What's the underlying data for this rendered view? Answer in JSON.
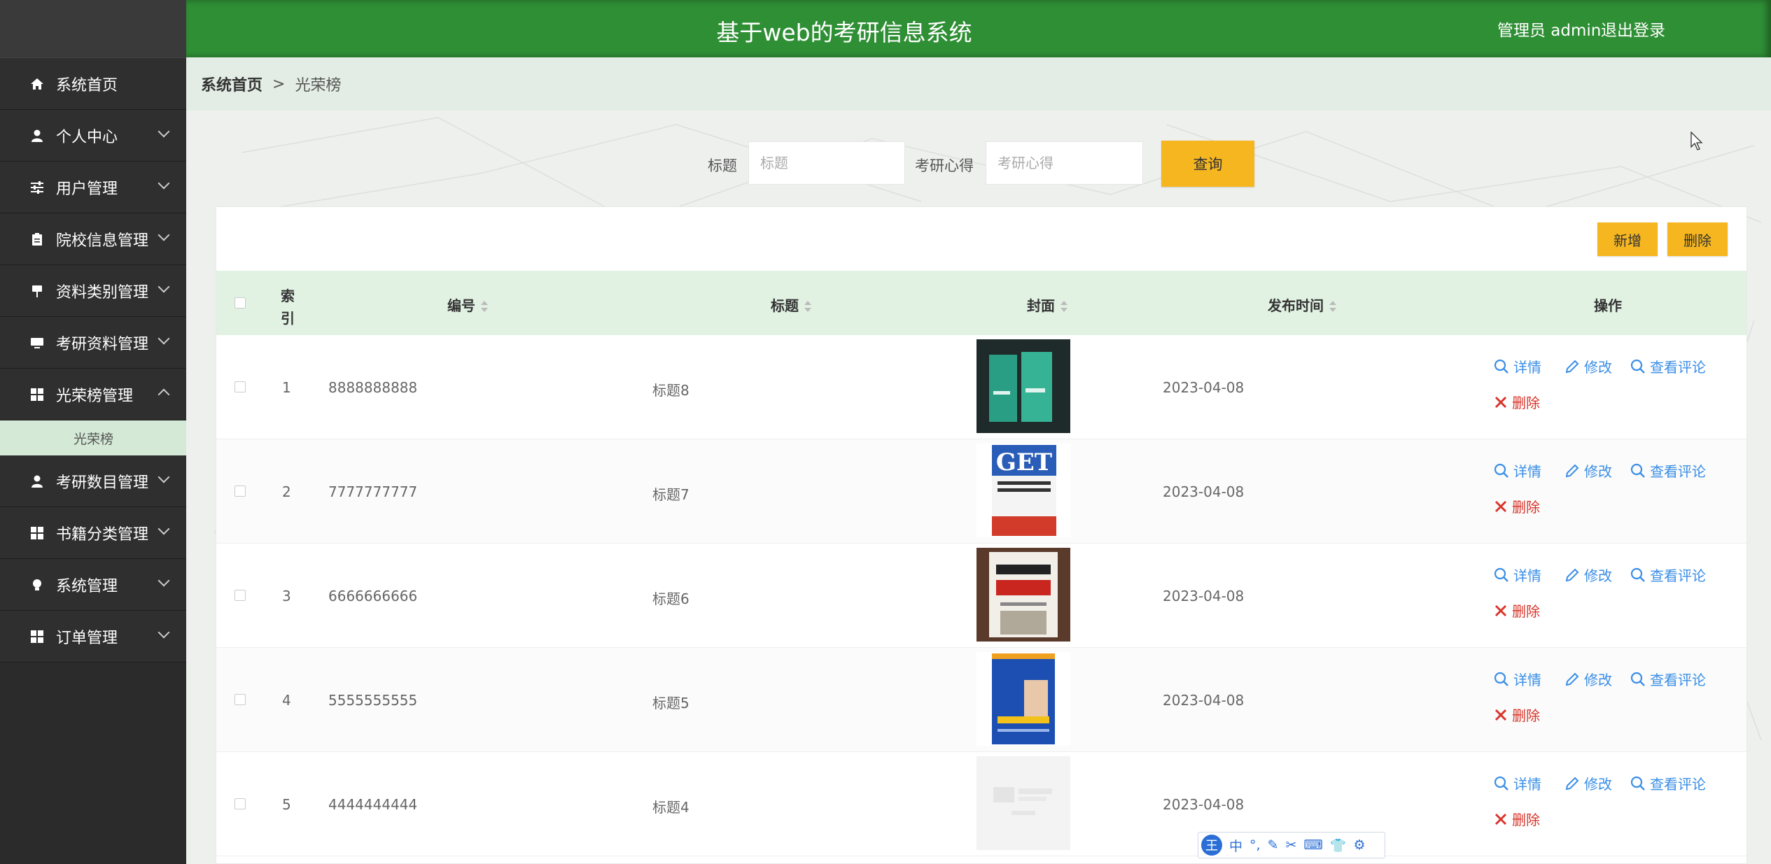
{
  "header": {
    "title": "基于web的考研信息系统",
    "user": "管理员 admin",
    "logout": "退出登录"
  },
  "sidebar": {
    "items": [
      {
        "label": "系统首页",
        "icon": "home-icon"
      },
      {
        "label": "个人中心",
        "icon": "user-icon"
      },
      {
        "label": "用户管理",
        "icon": "sliders-icon"
      },
      {
        "label": "院校信息管理",
        "icon": "clipboard-icon"
      },
      {
        "label": "资料类别管理",
        "icon": "sign-icon"
      },
      {
        "label": "考研资料管理",
        "icon": "monitor-icon"
      },
      {
        "label": "光荣榜管理",
        "icon": "grid-icon"
      },
      {
        "label": "考研数目管理",
        "icon": "user-icon"
      },
      {
        "label": "书籍分类管理",
        "icon": "grid-icon"
      },
      {
        "label": "系统管理",
        "icon": "bulb-icon"
      },
      {
        "label": "订单管理",
        "icon": "grid-icon"
      }
    ],
    "submenu": {
      "label": "光荣榜"
    }
  },
  "breadcrumb": {
    "home": "系统首页",
    "sep": ">",
    "current": "光荣榜"
  },
  "search": {
    "title_label": "标题",
    "title_placeholder": "标题",
    "xinde_label": "考研心得",
    "xinde_placeholder": "考研心得",
    "query": "查询"
  },
  "toolbar": {
    "add": "新增",
    "delete": "删除"
  },
  "table": {
    "headers": {
      "index": "索引",
      "number": "编号",
      "title": "标题",
      "cover": "封面",
      "date": "发布时间",
      "ops": "操作"
    },
    "rows": [
      {
        "index": "1",
        "number": "8888888888",
        "title": "标题8",
        "date": "2023-04-08",
        "cover": "green-book-cover"
      },
      {
        "index": "2",
        "number": "7777777777",
        "title": "标题7",
        "date": "2023-04-08",
        "cover": "get-book-cover"
      },
      {
        "index": "3",
        "number": "6666666666",
        "title": "标题6",
        "date": "2023-04-08",
        "cover": "english-book-cover"
      },
      {
        "index": "4",
        "number": "5555555555",
        "title": "标题5",
        "date": "2023-04-08",
        "cover": "blue-book-cover"
      },
      {
        "index": "5",
        "number": "4444444444",
        "title": "标题4",
        "date": "2023-04-08",
        "cover": "placeholder-cover"
      }
    ],
    "actions": {
      "detail": "详情",
      "edit": "修改",
      "comments": "查看评论",
      "delete": "删除"
    }
  },
  "ime": {
    "items": [
      "中",
      "°,",
      "✎",
      "✂",
      "⌨",
      "👕",
      "⚙"
    ]
  },
  "colors": {
    "header": "#2f8f35",
    "sidebar": "#2b2b2b",
    "accent": "#f6b61f",
    "link": "#3a8ee6",
    "danger": "#d9342b",
    "thead": "#e1f2e3"
  }
}
